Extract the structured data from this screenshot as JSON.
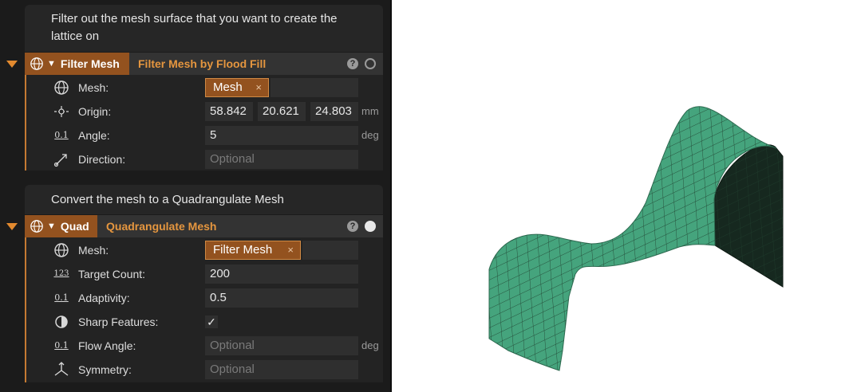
{
  "nodes": [
    {
      "description": "Filter out the mesh surface that you want to create the lattice on",
      "tag": "Filter Mesh",
      "title": "Filter Mesh by Flood Fill",
      "help": "?",
      "fields": {
        "mesh": {
          "label": "Mesh:",
          "chip": "Mesh"
        },
        "origin": {
          "label": "Origin:",
          "x": "58.842",
          "y": "20.621",
          "z": "24.803",
          "unit": "mm"
        },
        "angle": {
          "label": "Angle:",
          "value": "5",
          "unit": "deg"
        },
        "direction": {
          "label": "Direction:",
          "placeholder": "Optional"
        }
      }
    },
    {
      "description": "Convert the mesh to a Quadrangulate Mesh",
      "tag": "Quad",
      "title": "Quadrangulate Mesh",
      "help": "?",
      "fields": {
        "mesh": {
          "label": "Mesh:",
          "chip": "Filter Mesh"
        },
        "target_count": {
          "label": "Target Count:",
          "value": "200"
        },
        "adaptivity": {
          "label": "Adaptivity:",
          "value": "0.5"
        },
        "sharp_features": {
          "label": "Sharp Features:",
          "checked": "✓"
        },
        "flow_angle": {
          "label": "Flow Angle:",
          "placeholder": "Optional",
          "unit": "deg"
        },
        "symmetry": {
          "label": "Symmetry:",
          "placeholder": "Optional"
        }
      }
    }
  ],
  "icons": {
    "number_small": "0.1",
    "number_int": "123",
    "chip_close": "×"
  },
  "colors": {
    "accent": "#93521f",
    "accent_text": "#e5963f",
    "mesh_front": "#45a47d",
    "mesh_back": "#16281f"
  }
}
